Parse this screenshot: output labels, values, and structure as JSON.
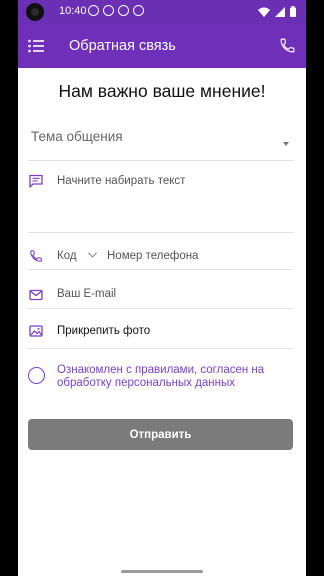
{
  "status_bar": {
    "time": "10:40"
  },
  "app_bar": {
    "title": "Обратная связь",
    "menu_icon": "menu-icon",
    "call_icon": "phone-icon"
  },
  "form": {
    "heading": "Нам важно ваше мнение!",
    "topic_placeholder": "Тема общения",
    "message_placeholder": "Начните набирать текст",
    "code_placeholder": "Код",
    "phone_placeholder": "Номер телефона",
    "email_placeholder": "Ваш E-mail",
    "attach_photo_label": "Прикрепить фото",
    "agreement_text": "Ознакомлен с правилами, согласен на обработку персональных данных",
    "submit_label": "Отправить"
  },
  "colors": {
    "accent": "#6f2fb8",
    "accent_text": "#7b3fc4",
    "button_disabled": "#7b7b7b"
  }
}
